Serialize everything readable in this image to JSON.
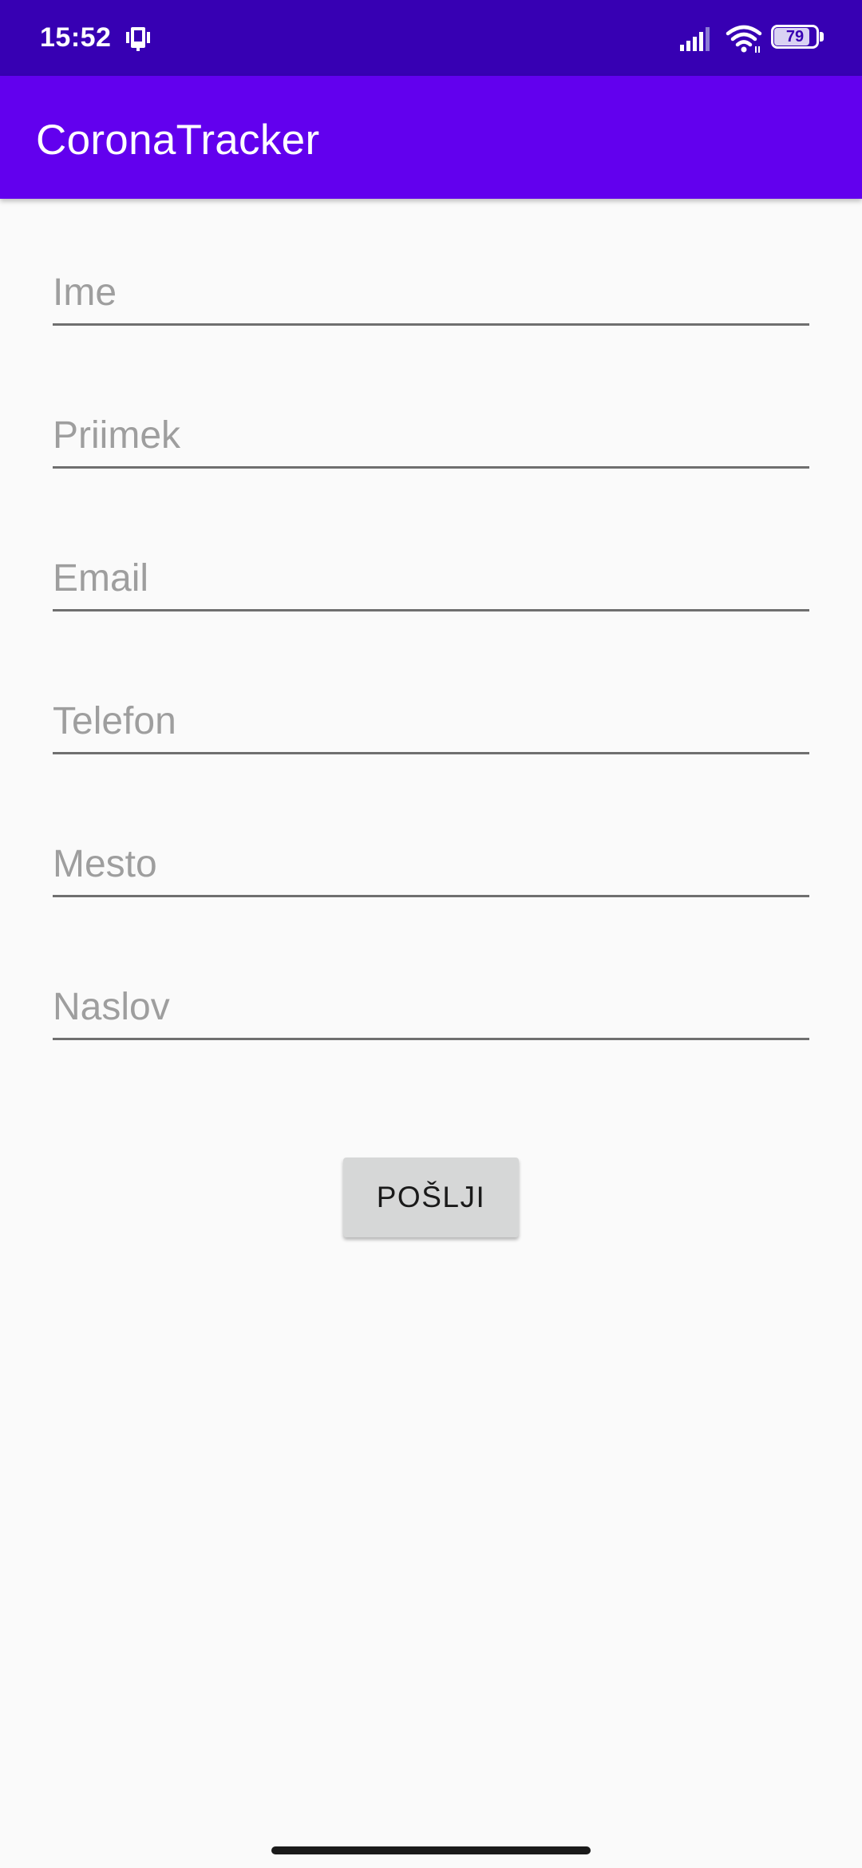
{
  "status_bar": {
    "time": "15:52",
    "battery_level": "79",
    "icons": [
      "nfc-icon",
      "signal-icon",
      "wifi-icon",
      "battery-icon"
    ]
  },
  "app_bar": {
    "title": "CoronaTracker"
  },
  "form": {
    "fields": [
      {
        "placeholder": "Ime",
        "value": ""
      },
      {
        "placeholder": "Priimek",
        "value": ""
      },
      {
        "placeholder": "Email",
        "value": ""
      },
      {
        "placeholder": "Telefon",
        "value": ""
      },
      {
        "placeholder": "Mesto",
        "value": ""
      },
      {
        "placeholder": "Naslov",
        "value": ""
      }
    ],
    "submit_label": "POŠLJI"
  },
  "colors": {
    "status_bar": "#3700b3",
    "primary": "#6200ee",
    "background": "#fafafa",
    "placeholder": "#9e9e9e",
    "button": "#d6d7d7"
  }
}
